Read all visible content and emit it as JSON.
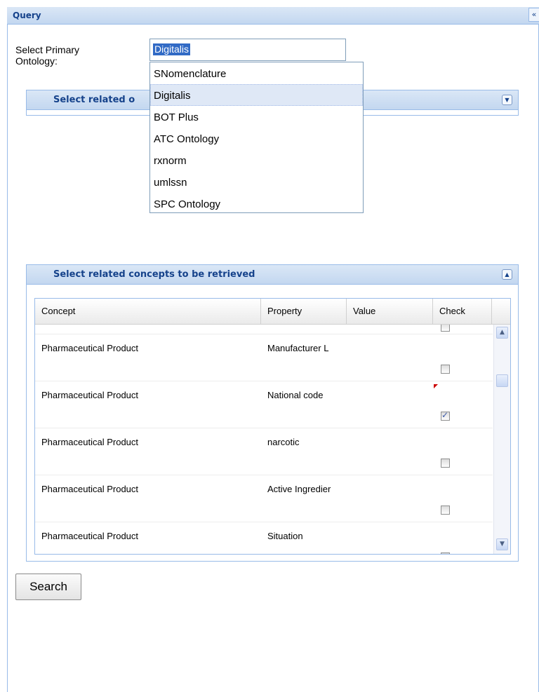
{
  "panel": {
    "title": "Query",
    "collapse_glyph": "«"
  },
  "primary_ontology": {
    "label": "Select Primary Ontology:",
    "value": "Digitalis",
    "options": [
      "SNomenclature",
      "Digitalis",
      "BOT Plus",
      "ATC Ontology",
      "rxnorm",
      "umlssn",
      "SPC Ontology"
    ],
    "selected": "Digitalis"
  },
  "related_ontologies": {
    "title_visible": "Select related o",
    "tool_icon": "chevron-down-icon"
  },
  "concepts_section": {
    "title": "Select related concepts to be retrieved",
    "tool_icon": "chevron-up-icon",
    "columns": [
      "Concept",
      "Property",
      "Value",
      "Check"
    ],
    "rows": [
      {
        "concept": "Pharmaceutical Product",
        "property": "Manufacturer L",
        "value": "",
        "checked": false,
        "dirty": false
      },
      {
        "concept": "Pharmaceutical Product",
        "property": "National code",
        "value": "",
        "checked": true,
        "dirty": true
      },
      {
        "concept": "Pharmaceutical Product",
        "property": "narcotic",
        "value": "",
        "checked": false,
        "dirty": false
      },
      {
        "concept": "Pharmaceutical Product",
        "property": "Active Ingredier",
        "value": "",
        "checked": false,
        "dirty": false
      },
      {
        "concept": "Pharmaceutical Product",
        "property": "Situation",
        "value": "",
        "checked": false,
        "dirty": false
      }
    ]
  },
  "search_button": {
    "label": "Search"
  },
  "colors": {
    "header_text": "#15428b",
    "border": "#99bbe8",
    "selection": "#316ac5"
  }
}
